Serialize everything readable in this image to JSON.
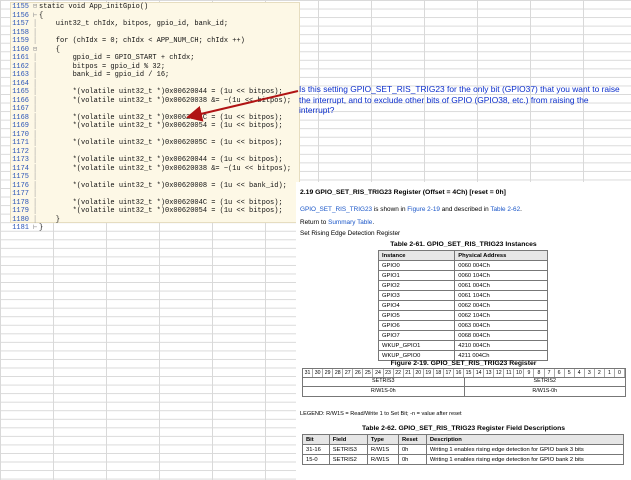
{
  "code": {
    "lines": [
      {
        "n": "1155",
        "f": "⊟",
        "t": "static void App_initGpio()"
      },
      {
        "n": "1156",
        "f": "⊢",
        "t": "{"
      },
      {
        "n": "1157",
        "f": "│",
        "t": "    uint32_t chIdx, bitpos, gpio_id, bank_id;"
      },
      {
        "n": "1158",
        "f": "│",
        "t": ""
      },
      {
        "n": "1159",
        "f": "│",
        "t": "    for (chIdx = 0; chIdx < APP_NUM_CH; chIdx ++)"
      },
      {
        "n": "1160",
        "f": "⊟",
        "t": "    {"
      },
      {
        "n": "1161",
        "f": "│",
        "t": "        gpio_id = GPIO_START + chIdx;"
      },
      {
        "n": "1162",
        "f": "│",
        "t": "        bitpos = gpio_id % 32;"
      },
      {
        "n": "1163",
        "f": "│",
        "t": "        bank_id = gpio_id / 16;"
      },
      {
        "n": "1164",
        "f": "│",
        "t": ""
      },
      {
        "n": "1165",
        "f": "│",
        "t": "        *(volatile uint32_t *)0x00620044 = (1u << bitpos);"
      },
      {
        "n": "1166",
        "f": "│",
        "t": "        *(volatile uint32_t *)0x00620038 &= ~(1u << bitpos);"
      },
      {
        "n": "1167",
        "f": "│",
        "t": ""
      },
      {
        "n": "1168",
        "f": "│",
        "t": "        *(volatile uint32_t *)0x0062004C = (1u << bitpos);"
      },
      {
        "n": "1169",
        "f": "│",
        "t": "        *(volatile uint32_t *)0x00620054 = (1u << bitpos);"
      },
      {
        "n": "1170",
        "f": "│",
        "t": ""
      },
      {
        "n": "1171",
        "f": "│",
        "t": "        *(volatile uint32_t *)0x0062005C = (1u << bitpos);"
      },
      {
        "n": "1172",
        "f": "│",
        "t": ""
      },
      {
        "n": "1173",
        "f": "│",
        "t": "        *(volatile uint32_t *)0x00620044 = (1u << bitpos);"
      },
      {
        "n": "1174",
        "f": "│",
        "t": "        *(volatile uint32_t *)0x00620038 &= ~(1u << bitpos);"
      },
      {
        "n": "1175",
        "f": "│",
        "t": ""
      },
      {
        "n": "1176",
        "f": "│",
        "t": "        *(volatile uint32_t *)0x00620008 = (1u << bank_id);"
      },
      {
        "n": "1177",
        "f": "│",
        "t": ""
      },
      {
        "n": "1178",
        "f": "│",
        "t": "        *(volatile uint32_t *)0x0062004C = (1u << bitpos);"
      },
      {
        "n": "1179",
        "f": "│",
        "t": "        *(volatile uint32_t *)0x00620054 = (1u << bitpos);"
      },
      {
        "n": "1180",
        "f": "│",
        "t": "    }"
      },
      {
        "n": "1181",
        "f": "⊢",
        "t": "}"
      }
    ]
  },
  "note": "Is this setting GPIO_SET_RIS_TRIG23 for the only bit (GPIO37) that you want to raise the interrupt, and to exclude other bits of GPIO (GPIO38, etc.) from raising the interrupt?",
  "doc": {
    "heading": "2.19 GPIO_SET_RIS_TRIG23 Register (Offset = 4Ch) [reset = 0h]",
    "p1_a": "GPIO_SET_RIS_TRIG23",
    "p1_b": " is shown in ",
    "p1_c": "Figure 2-19",
    "p1_d": " and described in ",
    "p1_e": "Table 2-62",
    "p1_f": ".",
    "p2_a": "Return to ",
    "p2_b": "Summary Table",
    "p2_c": ".",
    "p3": "Set Rising Edge Detection Register",
    "t61_caption": "Table 2-61. GPIO_SET_RIS_TRIG23 Instances",
    "t61_head": [
      "Instance",
      "Physical Address"
    ],
    "t61_rows": [
      [
        "GPIO0",
        "0060 004Ch"
      ],
      [
        "GPIO1",
        "0060 104Ch"
      ],
      [
        "GPIO2",
        "0061 004Ch"
      ],
      [
        "GPIO3",
        "0061 104Ch"
      ],
      [
        "GPIO4",
        "0062 004Ch"
      ],
      [
        "GPIO5",
        "0062 104Ch"
      ],
      [
        "GPIO6",
        "0063 004Ch"
      ],
      [
        "GPIO7",
        "0068 004Ch"
      ],
      [
        "WKUP_GPIO1",
        "4210 004Ch"
      ],
      [
        "WKUP_GPIO0",
        "4211 004Ch"
      ]
    ],
    "fig_caption": "Figure 2-19. GPIO_SET_RIS_TRIG23 Register",
    "bits": [
      "31",
      "30",
      "29",
      "28",
      "27",
      "26",
      "25",
      "24",
      "23",
      "22",
      "21",
      "20",
      "19",
      "18",
      "17",
      "16",
      "15",
      "14",
      "13",
      "12",
      "11",
      "10",
      "9",
      "8",
      "7",
      "6",
      "5",
      "4",
      "3",
      "2",
      "1",
      "0"
    ],
    "reg_names": [
      "SETRIS3",
      "SETRIS2"
    ],
    "reg_access": [
      "R/W1S-0h",
      "R/W1S-0h"
    ],
    "legend": "LEGEND: R/W1S = Read/Write 1 to Set Bit; -n = value after reset",
    "t62_caption": "Table 2-62. GPIO_SET_RIS_TRIG23 Register Field Descriptions",
    "t62_head": [
      "Bit",
      "Field",
      "Type",
      "Reset",
      "Description"
    ],
    "t62_rows": [
      [
        "31-16",
        "SETRIS3",
        "R/W1S",
        "0h",
        "Writing 1 enables rising edge detection for GPIO bank 3 bits"
      ],
      [
        "15-0",
        "SETRIS2",
        "R/W1S",
        "0h",
        "Writing 1 enables rising edge detection for GPIO bank 2 bits"
      ]
    ]
  }
}
